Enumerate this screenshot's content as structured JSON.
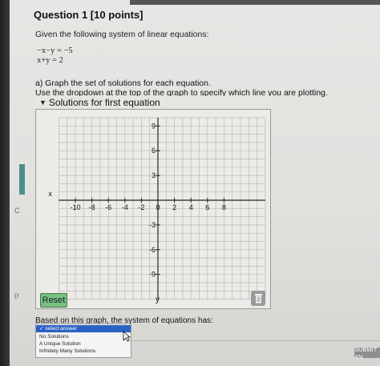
{
  "question": {
    "title": "Question 1 [10 points]",
    "prompt": "Given the following system of linear equations:",
    "equations": [
      "−x−y = −5",
      "x+y = 2"
    ],
    "part_a": "a) Graph the set of solutions for each equation.",
    "part_a_instructions": "Use the dropdown at the top of the graph to specify which line you are plotting."
  },
  "graph_dropdown": {
    "selected": "Solutions for first equation"
  },
  "graph": {
    "x_label": "x",
    "y_label": "y",
    "x_tick_labels": [
      "-10",
      "-8",
      "-6",
      "-4",
      "-2",
      "0",
      "2",
      "4",
      "6",
      "8"
    ],
    "y_tick_labels": [
      "9",
      "6",
      "3",
      "-3",
      "-6",
      "-9"
    ]
  },
  "controls": {
    "reset_label": "Reset",
    "trash_icon": "trash-icon"
  },
  "system_question": {
    "prompt": "Based on this graph, the system of equations has:",
    "options": [
      "select answer",
      "No Solutions",
      "A Unique Solution",
      "Infinitely Many Solutions"
    ],
    "selected": "select answer"
  },
  "submit": {
    "label": "SUBMIT AN"
  },
  "left_margin": {
    "marks": [
      "C",
      "(r"
    ]
  },
  "colors": {
    "reset_green": "#7bbf82",
    "select_highlight": "#2b63c4",
    "graph_bg": "#ecebe8"
  }
}
